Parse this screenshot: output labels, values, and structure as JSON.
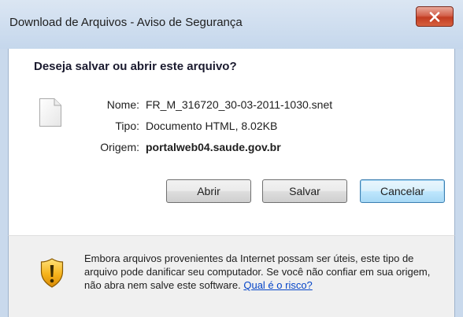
{
  "window": {
    "title": "Download de Arquivos - Aviso de Segurança"
  },
  "dialog": {
    "question": "Deseja salvar ou abrir este arquivo?",
    "file": {
      "name_label": "Nome:",
      "name_value": "FR_M_316720_30-03-2011-1030.snet",
      "type_label": "Tipo:",
      "type_value": "Documento HTML, 8.02KB",
      "origin_label": "Origem:",
      "origin_value": "portalweb04.saude.gov.br"
    },
    "buttons": {
      "open": "Abrir",
      "save": "Salvar",
      "cancel": "Cancelar"
    },
    "warning": {
      "text": "Embora arquivos provenientes da Internet possam ser úteis, este tipo de arquivo pode danificar seu computador. Se você não confiar em sua origem, não abra nem salve este software.",
      "link": "Qual é o risco?"
    }
  },
  "icons": {
    "close": "close-icon",
    "file": "file-icon",
    "warning": "warning-shield-icon"
  },
  "colors": {
    "close_button": "#c23c22",
    "link": "#0645c8",
    "default_button_border": "#3c7fb1"
  }
}
